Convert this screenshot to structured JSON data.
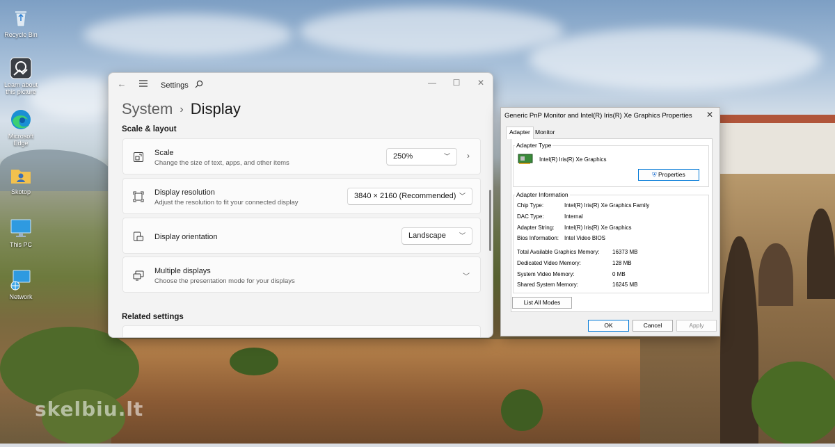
{
  "desktop": {
    "icons": [
      {
        "label": "Recycle Bin",
        "icon": "recycle-bin-icon"
      },
      {
        "label": "Learn about this picture",
        "icon": "camera-icon"
      },
      {
        "label": "Microsoft Edge",
        "icon": "edge-icon"
      },
      {
        "label": "Skotop",
        "icon": "user-folder-icon"
      },
      {
        "label": "This PC",
        "icon": "monitor-icon"
      },
      {
        "label": "Network",
        "icon": "network-icon"
      }
    ],
    "watermark": "skelbiu.lt"
  },
  "settings": {
    "app_title": "Settings",
    "breadcrumb": {
      "parent": "System",
      "separator": "›",
      "current": "Display"
    },
    "section_scale": "Scale & layout",
    "section_related": "Related settings",
    "cards": {
      "scale": {
        "title": "Scale",
        "subtitle": "Change the size of text, apps, and other items",
        "value": "250%",
        "icon": "scale-icon"
      },
      "resolution": {
        "title": "Display resolution",
        "subtitle": "Adjust the resolution to fit your connected display",
        "value": "3840 × 2160 (Recommended)",
        "icon": "resolution-icon"
      },
      "orientation": {
        "title": "Display orientation",
        "value": "Landscape",
        "icon": "orientation-icon"
      },
      "multiple": {
        "title": "Multiple displays",
        "subtitle": "Choose the presentation mode for your displays",
        "icon": "multiple-displays-icon"
      }
    }
  },
  "props": {
    "title": "Generic PnP Monitor and Intel(R) Iris(R) Xe Graphics Properties",
    "tabs": [
      "Adapter",
      "Monitor"
    ],
    "adapter_type": {
      "label": "Adapter Type",
      "name": "Intel(R) Iris(R) Xe Graphics",
      "properties_button": "Properties"
    },
    "adapter_info": {
      "label": "Adapter Information",
      "rows": [
        {
          "key": "Chip Type:",
          "value": "Intel(R) Iris(R) Xe Graphics Family"
        },
        {
          "key": "DAC Type:",
          "value": "Internal"
        },
        {
          "key": "Adapter String:",
          "value": "Intel(R) Iris(R) Xe Graphics"
        },
        {
          "key": "Bios Information:",
          "value": "Intel Video BIOS"
        }
      ],
      "memory": [
        {
          "key": "Total Available Graphics Memory:",
          "value": "16373 MB"
        },
        {
          "key": "Dedicated Video Memory:",
          "value": "128 MB"
        },
        {
          "key": "System Video Memory:",
          "value": "0 MB"
        },
        {
          "key": "Shared System Memory:",
          "value": "16245 MB"
        }
      ]
    },
    "list_all_modes": "List All Modes",
    "ok": "OK",
    "cancel": "Cancel",
    "apply": "Apply"
  }
}
